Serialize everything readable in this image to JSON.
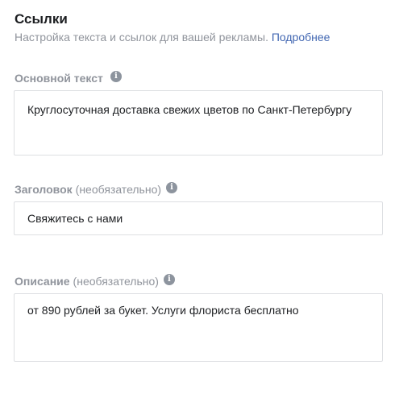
{
  "section": {
    "title": "Ссылки",
    "subtitle": "Настройка текста и ссылок для вашей рекламы.",
    "more_link": "Подробнее"
  },
  "fields": {
    "primary_text": {
      "label": "Основной текст",
      "value": "Круглосуточная доставка свежих цветов по Санкт-Петербургу",
      "info_icon": "info-icon"
    },
    "headline": {
      "label": "Заголовок",
      "optional": "(необязательно)",
      "value": "Свяжитесь с нами",
      "info_icon": "info-icon"
    },
    "description": {
      "label": "Описание",
      "optional": "(необязательно)",
      "value": "от 890 рублей за букет. Услуги флориста бесплатно",
      "info_icon": "info-icon"
    }
  },
  "colors": {
    "title": "#1c1e21",
    "muted": "#90949c",
    "link": "#4267b2",
    "border": "#dddfe2",
    "info_icon_bg": "#8d949e"
  }
}
